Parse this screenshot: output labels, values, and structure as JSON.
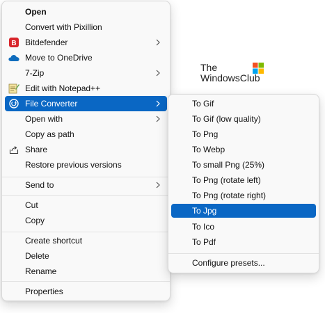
{
  "main_menu": {
    "items": [
      {
        "label": "Open"
      },
      {
        "label": "Convert with Pixillion"
      },
      {
        "label": "Bitdefender"
      },
      {
        "label": "Move to OneDrive"
      },
      {
        "label": "7-Zip"
      },
      {
        "label": "Edit with Notepad++"
      },
      {
        "label": "File Converter"
      },
      {
        "label": "Open with"
      },
      {
        "label": "Copy as path"
      },
      {
        "label": "Share"
      },
      {
        "label": "Restore previous versions"
      },
      {
        "label": "Send to"
      },
      {
        "label": "Cut"
      },
      {
        "label": "Copy"
      },
      {
        "label": "Create shortcut"
      },
      {
        "label": "Delete"
      },
      {
        "label": "Rename"
      },
      {
        "label": "Properties"
      }
    ]
  },
  "sub_menu": {
    "items": [
      {
        "label": "To Gif"
      },
      {
        "label": "To Gif (low quality)"
      },
      {
        "label": "To Png"
      },
      {
        "label": "To Webp"
      },
      {
        "label": "To small Png (25%)"
      },
      {
        "label": "To Png (rotate left)"
      },
      {
        "label": "To Png (rotate right)"
      },
      {
        "label": "To Jpg"
      },
      {
        "label": "To Ico"
      },
      {
        "label": "To Pdf"
      },
      {
        "label": "Configure presets..."
      }
    ]
  },
  "watermark": {
    "line1": "The",
    "line2": "WindowsClub"
  },
  "colors": {
    "highlight": "#0a67c4",
    "menu_bg": "#f9f9f9",
    "bitdefender": "#d8252b",
    "onedrive": "#0f6cbd"
  },
  "icons": {
    "bitdefender": "bitdefender-icon",
    "onedrive": "onedrive-icon",
    "notepad": "notepad-icon",
    "file_converter": "file-converter-icon",
    "share": "share-icon",
    "submenu_arrow": "chevron-right-icon"
  }
}
